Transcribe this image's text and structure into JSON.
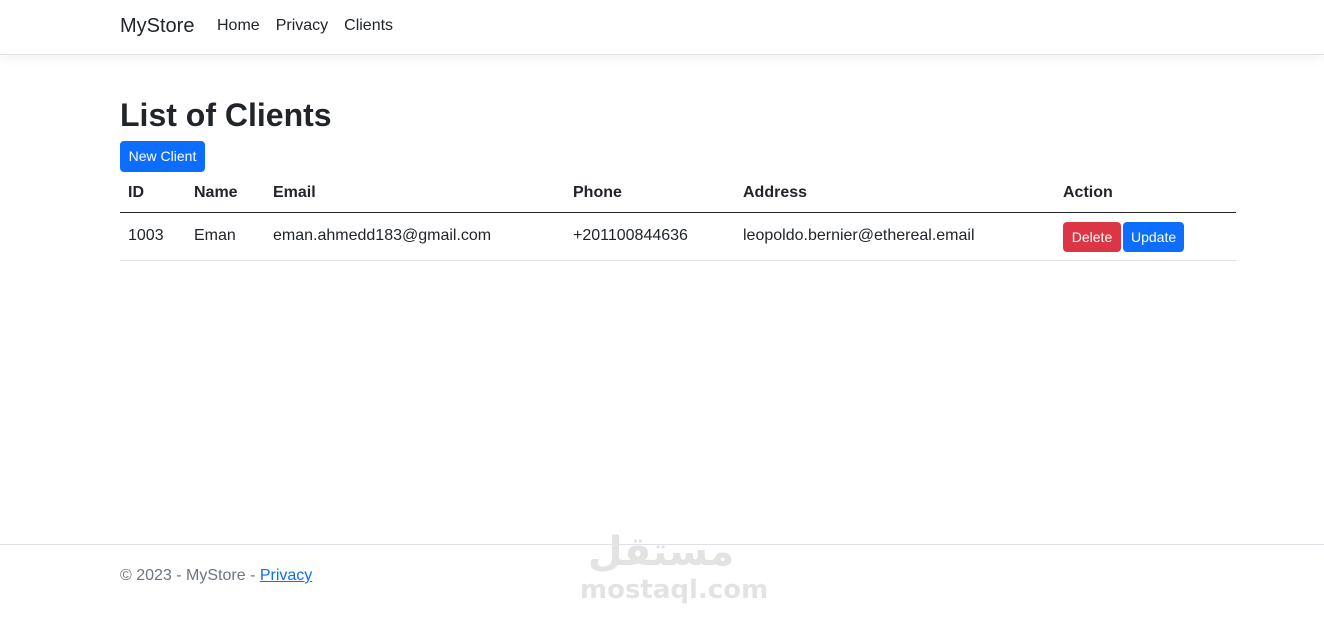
{
  "navbar": {
    "brand": "MyStore",
    "links": [
      "Home",
      "Privacy",
      "Clients"
    ]
  },
  "main": {
    "title": "List of Clients",
    "new_button": "New Client",
    "table": {
      "headers": [
        "ID",
        "Name",
        "Email",
        "Phone",
        "Address",
        "Action"
      ],
      "rows": [
        {
          "id": "1003",
          "name": "Eman",
          "email": "eman.ahmedd183@gmail.com",
          "phone": "+201100844636",
          "address": "leopoldo.bernier@ethereal.email",
          "delete_label": "Delete",
          "update_label": "Update"
        }
      ]
    }
  },
  "footer": {
    "text": "© 2023 - MyStore - ",
    "link": "Privacy"
  },
  "watermark": {
    "arabic": "مستقل",
    "latin": "mostaql.com"
  },
  "colors": {
    "primary": "#0d6efd",
    "danger": "#dc3545",
    "text": "#212529",
    "muted": "#6c757d"
  }
}
